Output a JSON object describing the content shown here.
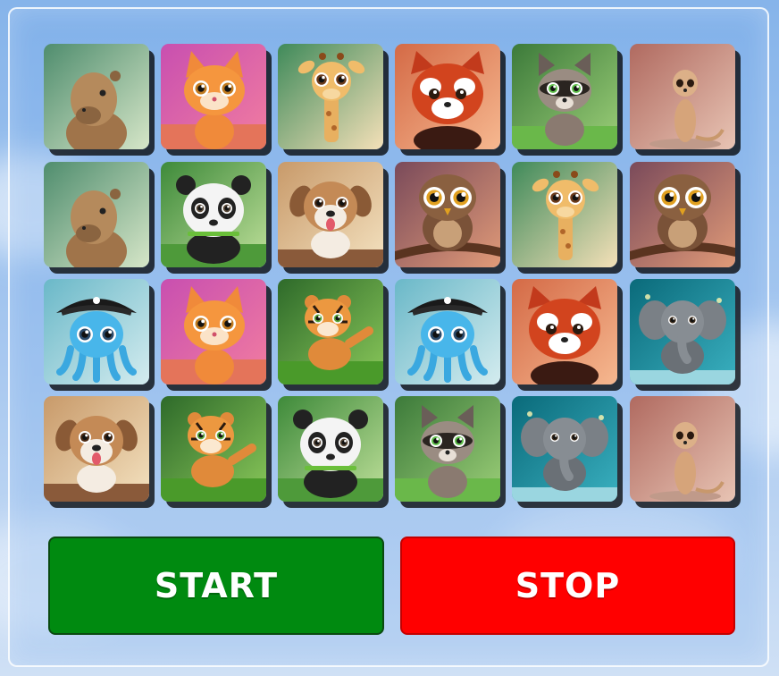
{
  "controls": {
    "start_label": "START",
    "stop_label": "STOP"
  },
  "colors": {
    "start": "#008a10",
    "stop": "#ff0000"
  },
  "board": {
    "columns": 6,
    "rows": 4,
    "cards": [
      "capybara",
      "orange-kitten",
      "giraffe",
      "red-panda",
      "raccoon",
      "meerkat",
      "capybara",
      "panda",
      "puppy",
      "owl",
      "giraffe",
      "owl",
      "pirate-octopus",
      "orange-kitten",
      "tiger",
      "pirate-octopus",
      "red-panda",
      "elephant",
      "puppy",
      "tiger",
      "panda",
      "raccoon",
      "elephant",
      "meerkat"
    ]
  }
}
